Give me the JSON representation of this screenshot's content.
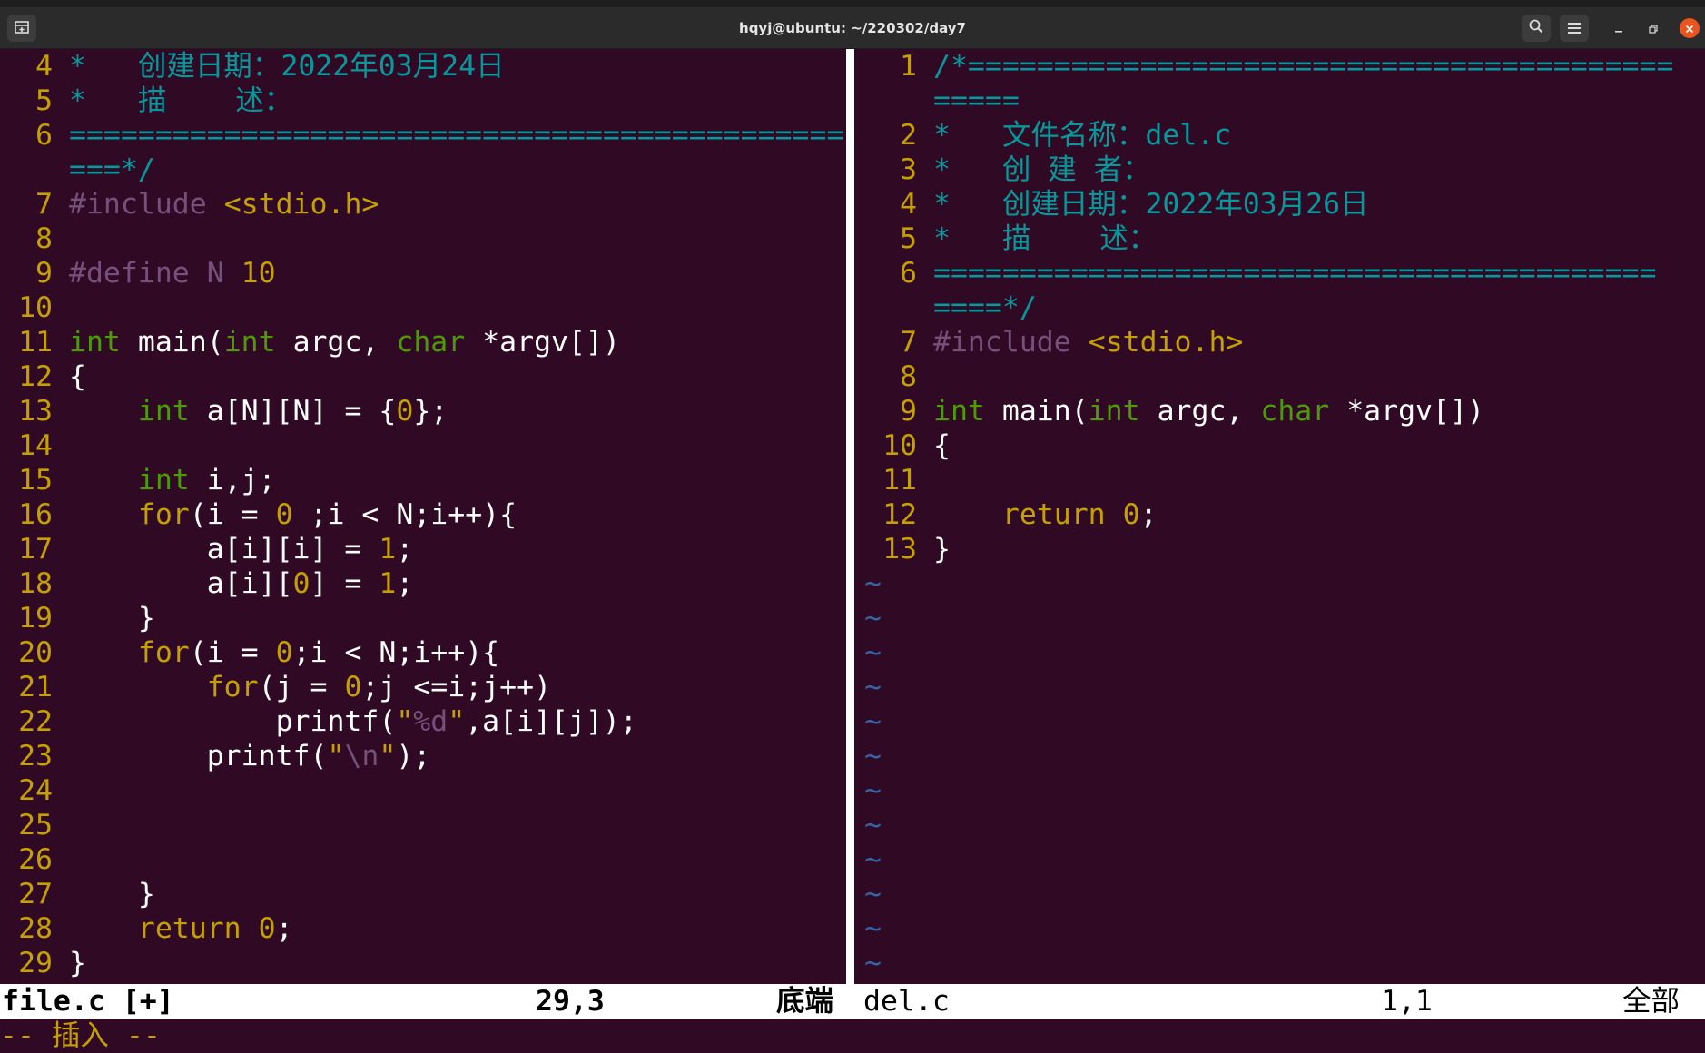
{
  "window": {
    "title": "hqyj@ubuntu: ~/220302/day7",
    "icons": {
      "new_tab": "new-tab-icon",
      "search": "search-icon",
      "menu": "hamburger-menu-icon",
      "minimize": "minimize-icon",
      "maximize": "maximize-icon",
      "close": "close-icon"
    }
  },
  "left_pane": {
    "lines": [
      {
        "n": "4",
        "parts": [
          {
            "t": "*   创建日期：2022年03月24日",
            "c": "cmt"
          }
        ]
      },
      {
        "n": "5",
        "parts": [
          {
            "t": "*   描    述：",
            "c": "cmt"
          }
        ]
      },
      {
        "n": "6",
        "parts": [
          {
            "t": "=============================================",
            "c": "cmt"
          }
        ]
      },
      {
        "n": "",
        "parts": [
          {
            "t": "===*/",
            "c": "cmt"
          }
        ]
      },
      {
        "n": "7",
        "parts": [
          {
            "t": "#include ",
            "c": "pre"
          },
          {
            "t": "<stdio.h>",
            "c": "str"
          }
        ]
      },
      {
        "n": "8",
        "parts": []
      },
      {
        "n": "9",
        "parts": [
          {
            "t": "#define N ",
            "c": "pre"
          },
          {
            "t": "10",
            "c": "num"
          }
        ]
      },
      {
        "n": "10",
        "parts": []
      },
      {
        "n": "11",
        "parts": [
          {
            "t": "int",
            "c": "typ"
          },
          {
            "t": " main(",
            "c": ""
          },
          {
            "t": "int",
            "c": "typ"
          },
          {
            "t": " argc, ",
            "c": ""
          },
          {
            "t": "char",
            "c": "typ"
          },
          {
            "t": " *argv[])",
            "c": ""
          }
        ]
      },
      {
        "n": "12",
        "parts": [
          {
            "t": "{",
            "c": ""
          }
        ]
      },
      {
        "n": "13",
        "parts": [
          {
            "t": "    ",
            "c": ""
          },
          {
            "t": "int",
            "c": "typ"
          },
          {
            "t": " a[N][N] = {",
            "c": ""
          },
          {
            "t": "0",
            "c": "num"
          },
          {
            "t": "};",
            "c": ""
          }
        ]
      },
      {
        "n": "14",
        "parts": []
      },
      {
        "n": "15",
        "parts": [
          {
            "t": "    ",
            "c": ""
          },
          {
            "t": "int",
            "c": "typ"
          },
          {
            "t": " i,j;",
            "c": ""
          }
        ]
      },
      {
        "n": "16",
        "parts": [
          {
            "t": "    ",
            "c": ""
          },
          {
            "t": "for",
            "c": "kw"
          },
          {
            "t": "(i = ",
            "c": ""
          },
          {
            "t": "0",
            "c": "num"
          },
          {
            "t": " ;i < N;i++){",
            "c": ""
          }
        ]
      },
      {
        "n": "17",
        "parts": [
          {
            "t": "        a[i][i] = ",
            "c": ""
          },
          {
            "t": "1",
            "c": "num"
          },
          {
            "t": ";",
            "c": ""
          }
        ]
      },
      {
        "n": "18",
        "parts": [
          {
            "t": "        a[i][",
            "c": ""
          },
          {
            "t": "0",
            "c": "num"
          },
          {
            "t": "] = ",
            "c": ""
          },
          {
            "t": "1",
            "c": "num"
          },
          {
            "t": ";",
            "c": ""
          }
        ]
      },
      {
        "n": "19",
        "parts": [
          {
            "t": "    }",
            "c": ""
          }
        ]
      },
      {
        "n": "20",
        "parts": [
          {
            "t": "    ",
            "c": ""
          },
          {
            "t": "for",
            "c": "kw"
          },
          {
            "t": "(i = ",
            "c": ""
          },
          {
            "t": "0",
            "c": "num"
          },
          {
            "t": ";i < N;i++){",
            "c": ""
          }
        ]
      },
      {
        "n": "21",
        "parts": [
          {
            "t": "        ",
            "c": ""
          },
          {
            "t": "for",
            "c": "kw"
          },
          {
            "t": "(j = ",
            "c": ""
          },
          {
            "t": "0",
            "c": "num"
          },
          {
            "t": ";j <=i;j++)",
            "c": ""
          }
        ]
      },
      {
        "n": "22",
        "parts": [
          {
            "t": "            printf(",
            "c": ""
          },
          {
            "t": "\"",
            "c": "str"
          },
          {
            "t": "%d",
            "c": "fmt"
          },
          {
            "t": "\"",
            "c": "str"
          },
          {
            "t": ",a[i][j]);",
            "c": ""
          }
        ]
      },
      {
        "n": "23",
        "parts": [
          {
            "t": "        printf(",
            "c": ""
          },
          {
            "t": "\"",
            "c": "str"
          },
          {
            "t": "\\n",
            "c": "fmt"
          },
          {
            "t": "\"",
            "c": "str"
          },
          {
            "t": ");",
            "c": ""
          }
        ]
      },
      {
        "n": "24",
        "parts": []
      },
      {
        "n": "25",
        "parts": []
      },
      {
        "n": "26",
        "parts": []
      },
      {
        "n": "27",
        "parts": [
          {
            "t": "    }",
            "c": ""
          }
        ]
      },
      {
        "n": "28",
        "parts": [
          {
            "t": "    ",
            "c": ""
          },
          {
            "t": "return",
            "c": "kw"
          },
          {
            "t": " ",
            "c": ""
          },
          {
            "t": "0",
            "c": "num"
          },
          {
            "t": ";",
            "c": ""
          }
        ]
      },
      {
        "n": "29",
        "parts": [
          {
            "t": "}",
            "c": ""
          }
        ]
      }
    ]
  },
  "right_pane": {
    "lines": [
      {
        "n": "1",
        "parts": [
          {
            "t": "/*=========================================",
            "c": "cmt"
          }
        ]
      },
      {
        "n": "",
        "parts": [
          {
            "t": "=====",
            "c": "cmt"
          }
        ]
      },
      {
        "n": "2",
        "parts": [
          {
            "t": "*   文件名称：del.c",
            "c": "cmt"
          }
        ]
      },
      {
        "n": "3",
        "parts": [
          {
            "t": "*   创 建 者：",
            "c": "cmt"
          }
        ]
      },
      {
        "n": "4",
        "parts": [
          {
            "t": "*   创建日期：2022年03月26日",
            "c": "cmt"
          }
        ]
      },
      {
        "n": "5",
        "parts": [
          {
            "t": "*   描    述：",
            "c": "cmt"
          }
        ]
      },
      {
        "n": "6",
        "parts": [
          {
            "t": "==========================================",
            "c": "cmt"
          }
        ]
      },
      {
        "n": "",
        "parts": [
          {
            "t": "====*/",
            "c": "cmt"
          }
        ]
      },
      {
        "n": "7",
        "parts": [
          {
            "t": "#include ",
            "c": "pre"
          },
          {
            "t": "<stdio.h>",
            "c": "str"
          }
        ]
      },
      {
        "n": "8",
        "parts": []
      },
      {
        "n": "9",
        "parts": [
          {
            "t": "int",
            "c": "typ"
          },
          {
            "t": " main(",
            "c": ""
          },
          {
            "t": "int",
            "c": "typ"
          },
          {
            "t": " argc, ",
            "c": ""
          },
          {
            "t": "char",
            "c": "typ"
          },
          {
            "t": " *argv[])",
            "c": ""
          }
        ]
      },
      {
        "n": "10",
        "parts": [
          {
            "t": "{",
            "c": ""
          }
        ]
      },
      {
        "n": "11",
        "parts": []
      },
      {
        "n": "12",
        "parts": [
          {
            "t": "    ",
            "c": ""
          },
          {
            "t": "return",
            "c": "kw"
          },
          {
            "t": " ",
            "c": ""
          },
          {
            "t": "0",
            "c": "num"
          },
          {
            "t": ";",
            "c": ""
          }
        ]
      },
      {
        "n": "13",
        "parts": [
          {
            "t": "}",
            "c": ""
          }
        ]
      }
    ],
    "filler": "~",
    "filler_count": 12
  },
  "statusbar": {
    "left_file": "file.c [+]",
    "left_pos": "29,3",
    "left_scroll": "底端",
    "right_file": "del.c",
    "right_pos": "1,1",
    "right_scroll": "全部"
  },
  "cmdline": {
    "text": "-- 插入 --"
  }
}
